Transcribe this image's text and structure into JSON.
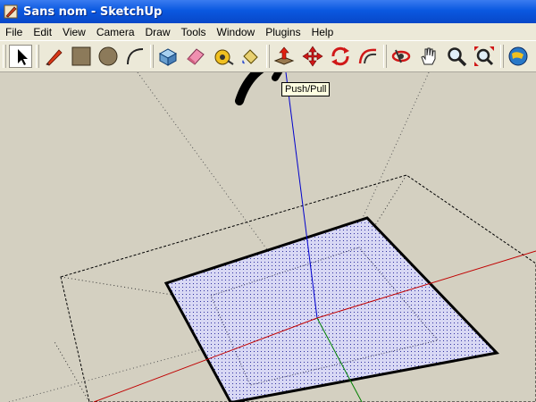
{
  "window": {
    "title": "Sans nom - SketchUp",
    "icon": "sketchup-pencil-icon"
  },
  "menu": [
    "File",
    "Edit",
    "View",
    "Camera",
    "Draw",
    "Tools",
    "Window",
    "Plugins",
    "Help"
  ],
  "toolbar": {
    "tools": [
      {
        "name": "select-icon"
      },
      {
        "name": "line-pencil-icon"
      },
      {
        "name": "rectangle-icon"
      },
      {
        "name": "circle-icon"
      },
      {
        "name": "arc-icon"
      },
      {
        "name": "make-component-icon"
      },
      {
        "name": "eraser-icon"
      },
      {
        "name": "tape-measure-icon"
      },
      {
        "name": "paint-bucket-icon"
      },
      {
        "name": "push-pull-icon",
        "pressed": true
      },
      {
        "name": "move-icon"
      },
      {
        "name": "rotate-icon"
      },
      {
        "name": "offset-icon"
      },
      {
        "name": "orbit-icon"
      },
      {
        "name": "pan-icon"
      },
      {
        "name": "zoom-icon"
      },
      {
        "name": "zoom-extents-icon"
      },
      {
        "name": "get-models-icon"
      }
    ]
  },
  "tooltip": {
    "text": "Push/Pull"
  },
  "colors": {
    "titlebar": "#0a58e0",
    "viewport_bg": "#d4d0c1",
    "face_fill": "#c8c8f0",
    "axis_red": "#c00000",
    "axis_green": "#008000",
    "axis_blue": "#0000cc"
  }
}
